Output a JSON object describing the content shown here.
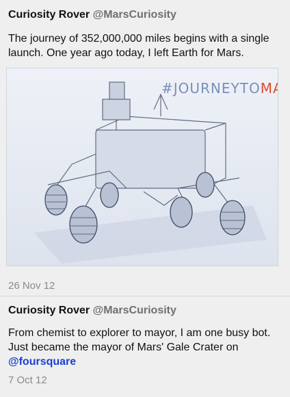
{
  "tweets": [
    {
      "name": "Curiosity Rover",
      "handle": "@MarsCuriosity",
      "text": "The journey of 352,000,000 miles begins with a single launch. One year ago today, I left Earth for Mars.",
      "image": {
        "hashtag_prefix": "#JOURNEYTO",
        "hashtag_accent": "MARS",
        "accent_color": "#e04a2f",
        "hashtag_color": "#7b8fb8"
      },
      "date": "26 Nov 12"
    },
    {
      "name": "Curiosity Rover",
      "handle": "@MarsCuriosity",
      "text": "From chemist to explorer to mayor, I am one busy bot. Just became the mayor of Mars' Gale Crater on",
      "mention": "@foursquare",
      "date": "7 Oct 12"
    }
  ]
}
